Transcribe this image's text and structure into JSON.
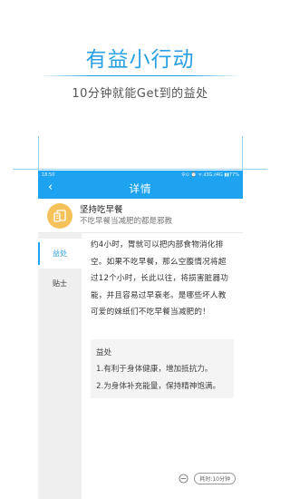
{
  "promo": {
    "title": "有益小行动",
    "subtitle": "10分钟就能Get到的益处"
  },
  "statusbar": {
    "time": "18:50",
    "indicators": "令⊙ ⌚ ᯤ.ıl3G.ıl4G ▮▮77%"
  },
  "navbar": {
    "back": "‹",
    "title": "详情"
  },
  "item": {
    "title": "坚持吃早餐",
    "subtitle": "不吃早餐当减肥的都是邪教"
  },
  "tabs": [
    {
      "label": "益处"
    },
    {
      "label": "贴士"
    }
  ],
  "content": {
    "main_text": "约4小时，胃就可以把内部食物消化排空。如果不吃早餐，那么空腹情况将超过12个小时，长此以往，将损害脏器功能，并且容易过早衰老。是哪些坏人教可爱的妹纸们不吃早餐当减肥的！",
    "benefit_heading": "益处",
    "benefit_1": "1.有利于身体健康，增加抵抗力。",
    "benefit_2": "2.为身体补充能量，保持精神饱满。"
  },
  "footer": {
    "time_badge": "耗时:10分钟"
  },
  "colors": {
    "accent": "#1da3f0",
    "title_blue": "#2aa0e4",
    "icon_bg": "#f5c15a"
  }
}
